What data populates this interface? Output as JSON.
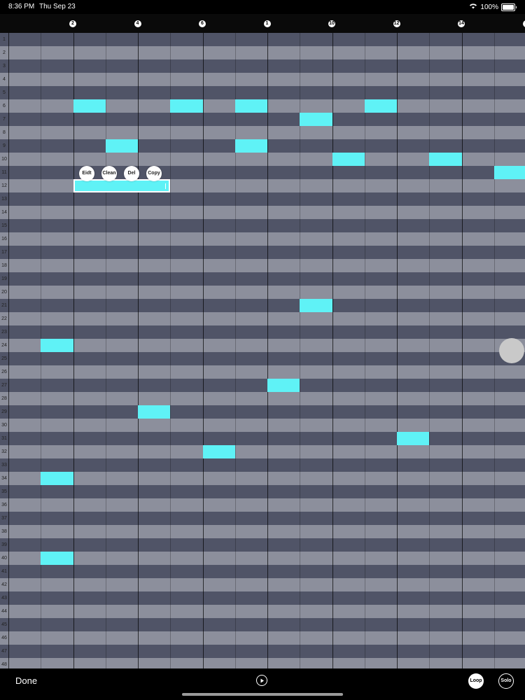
{
  "status": {
    "time": "8:36 PM",
    "date": "Thu Sep 23",
    "battery": "100%"
  },
  "ruler": {
    "markers": [
      "2",
      "4",
      "6",
      "1",
      "10",
      "12",
      "14",
      "1"
    ]
  },
  "rows": [
    "1",
    "2",
    "3",
    "4",
    "5",
    "6",
    "7",
    "8",
    "9",
    "10",
    "11",
    "12",
    "13",
    "14",
    "15",
    "16",
    "17",
    "18",
    "19",
    "20",
    "21",
    "22",
    "23",
    "24",
    "25",
    "26",
    "27",
    "28",
    "29",
    "30",
    "31",
    "32",
    "33",
    "34",
    "35",
    "36",
    "37",
    "38",
    "39",
    "40",
    "41",
    "42",
    "43",
    "44",
    "45",
    "46",
    "47",
    "48"
  ],
  "notes": [
    {
      "row": 6,
      "step": 2,
      "len": 1
    },
    {
      "row": 6,
      "step": 5,
      "len": 1
    },
    {
      "row": 6,
      "step": 7,
      "len": 1
    },
    {
      "row": 6,
      "step": 11,
      "len": 1
    },
    {
      "row": 7,
      "step": 9,
      "len": 1
    },
    {
      "row": 9,
      "step": 3,
      "len": 1
    },
    {
      "row": 9,
      "step": 7,
      "len": 1
    },
    {
      "row": 10,
      "step": 10,
      "len": 1
    },
    {
      "row": 10,
      "step": 13,
      "len": 1
    },
    {
      "row": 11,
      "step": 15,
      "len": 1
    },
    {
      "row": 12,
      "step": 2,
      "len": 3,
      "selected": true
    },
    {
      "row": 21,
      "step": 9,
      "len": 1
    },
    {
      "row": 24,
      "step": 1,
      "len": 1
    },
    {
      "row": 27,
      "step": 8,
      "len": 1
    },
    {
      "row": 29,
      "step": 4,
      "len": 1
    },
    {
      "row": 31,
      "step": 12,
      "len": 1
    },
    {
      "row": 32,
      "step": 6,
      "len": 1
    },
    {
      "row": 34,
      "step": 1,
      "len": 1
    },
    {
      "row": 40,
      "step": 1,
      "len": 1
    }
  ],
  "context_menu": {
    "edit": "Eidt",
    "clean": "Clean",
    "del": "Del",
    "copy": "Copy"
  },
  "toolbar": {
    "done": "Done",
    "loop": "Loop",
    "solo": "Solo"
  },
  "colors": {
    "note": "#5ff2f6",
    "row_light": "#8c8f9c",
    "row_dark": "#505467"
  }
}
